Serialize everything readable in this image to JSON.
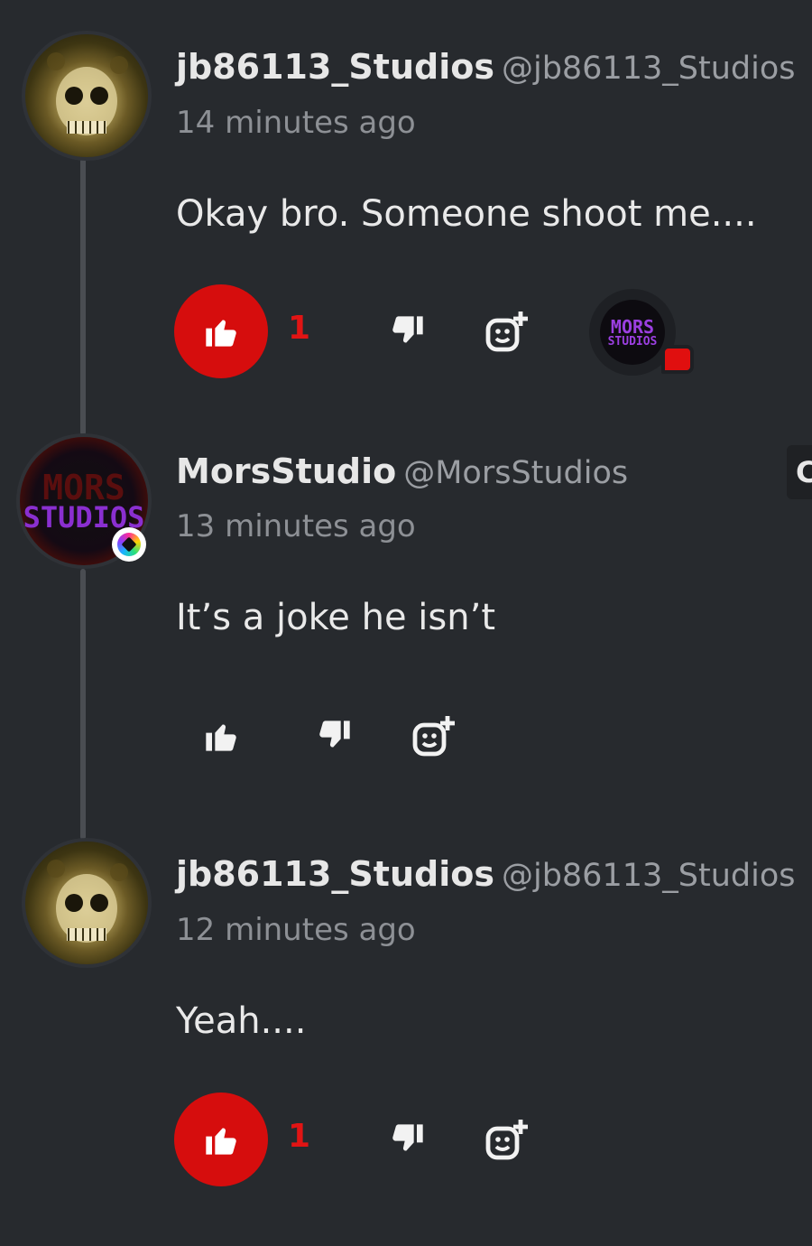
{
  "comments": [
    {
      "username": "jb86113_Studios",
      "handle": "@jb86113_Studios",
      "timestamp": "14 minutes ago",
      "text": "Okay bro. Someone shoot me....",
      "likes": "1",
      "liked": true,
      "avatar": "skull-avatar"
    },
    {
      "username": "MorsStudio",
      "handle": "@MorsStudios",
      "timestamp": "13 minutes ago",
      "text": "It’s a joke he isn’t",
      "likes": "",
      "liked": false,
      "avatar": "mors-avatar",
      "avatar_text": [
        "MORS",
        "STUDIOS"
      ]
    },
    {
      "username": "jb86113_Studios",
      "handle": "@jb86113_Studios",
      "timestamp": "12 minutes ago",
      "text": "Yeah....",
      "likes": "1",
      "liked": true,
      "avatar": "skull-avatar"
    }
  ],
  "reply_preview": {
    "avatar_text": [
      "MORS",
      "STUDIOS"
    ]
  },
  "side_tab": {
    "label": "C"
  },
  "colors": {
    "background": "#272a2e",
    "like_active": "#d60d0d",
    "like_count": "#e11414",
    "text": "#e9e9e9",
    "muted": "#8d9095"
  },
  "icons": {
    "like": "thumbs-up-icon",
    "dislike": "thumbs-down-icon",
    "react": "add-reaction-icon"
  }
}
